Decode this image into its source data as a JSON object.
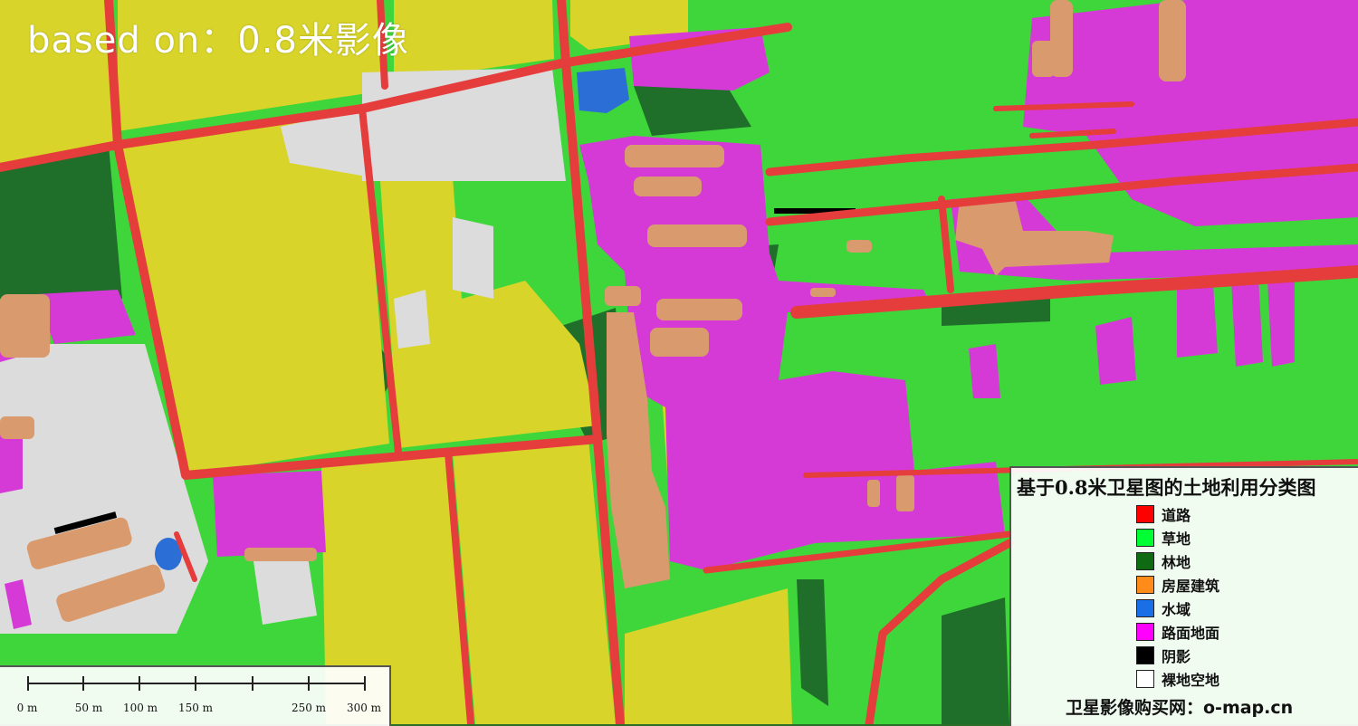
{
  "overlay_title": "based on：0.8米影像",
  "legend": {
    "title": "基于0.8米卫星图的土地利用分类图",
    "items": [
      {
        "label": "道路",
        "color": "#ff0000"
      },
      {
        "label": "草地",
        "color": "#00ff33"
      },
      {
        "label": "林地",
        "color": "#0e6b12"
      },
      {
        "label": "房屋建筑",
        "color": "#ff8c1a"
      },
      {
        "label": "水域",
        "color": "#1a6ee6"
      },
      {
        "label": "路面地面",
        "color": "#ff00ff"
      },
      {
        "label": "阴影",
        "color": "#000000"
      },
      {
        "label": "裸地空地",
        "color": "#ffffff"
      }
    ],
    "website": "卫星影像购买网：o-map.cn"
  },
  "scalebar": {
    "labels": [
      "0 m",
      "50 m",
      "100 m",
      "150 m",
      "250 m",
      "300 m"
    ]
  },
  "colors": {
    "farmland": "#d8d42a",
    "grass": "#3ed63a",
    "forest": "#1f6e2a",
    "road": "#e53c3c",
    "pavement": "#d63ad6",
    "building": "#d99a6e",
    "water": "#2a6ed6",
    "bare": "#dcdcdc"
  }
}
